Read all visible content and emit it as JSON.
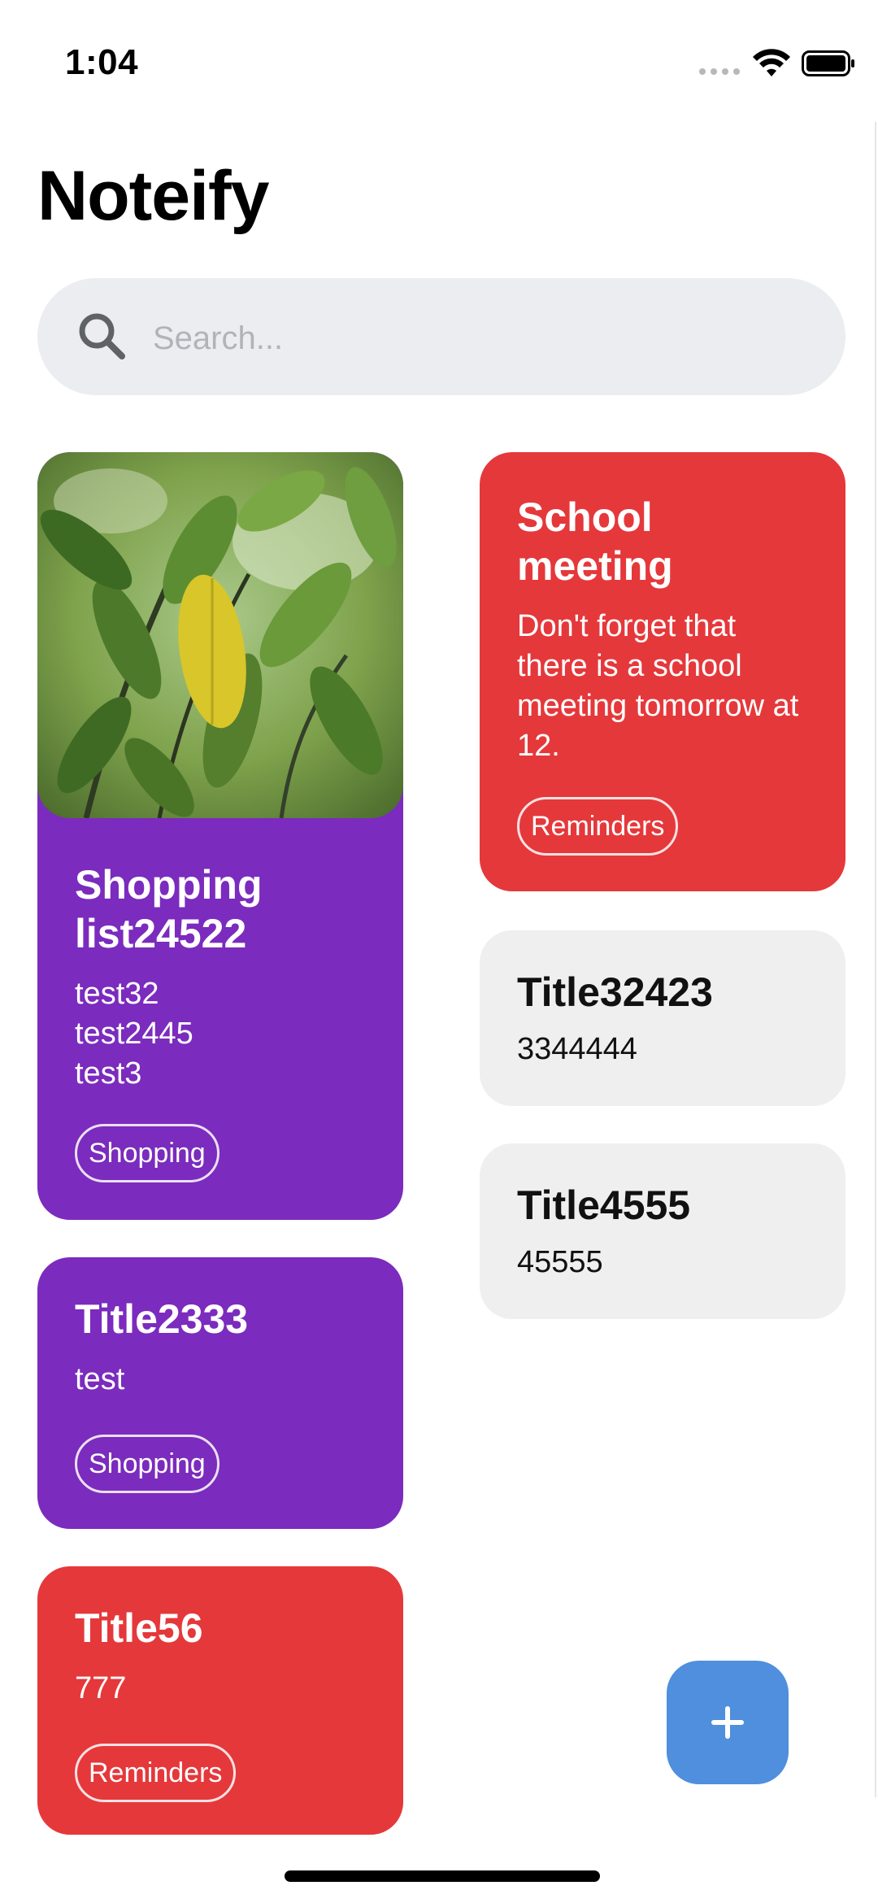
{
  "status_bar": {
    "time": "1:04"
  },
  "app": {
    "title": "Noteify"
  },
  "search": {
    "placeholder": "Search...",
    "value": "",
    "icon": "search-icon"
  },
  "notes": [
    {
      "id": "n1",
      "title": "Shopping list24522",
      "text": "test32\ntest2445\ntest3",
      "tag": "Shopping",
      "color": "#7b2bbd",
      "image": "plant-leaves-photo"
    },
    {
      "id": "n2",
      "title": "School meeting",
      "text": "Don't forget that there is a school meeting tomorrow at 12.",
      "tag": "Reminders",
      "color": "#e5383b"
    },
    {
      "id": "n3",
      "title": "Title32423",
      "text": "3344444",
      "color": "#efefef"
    },
    {
      "id": "n4",
      "title": "Title4555",
      "text": "45555",
      "color": "#efefef"
    },
    {
      "id": "n5",
      "title": "Title2333",
      "text": "test",
      "tag": "Shopping",
      "color": "#7b2bbd"
    },
    {
      "id": "n6",
      "title": "Title56",
      "text": "777",
      "tag": "Reminders",
      "color": "#e5383b"
    }
  ],
  "fab": {
    "icon": "plus-icon",
    "color": "#4f8fdd"
  }
}
